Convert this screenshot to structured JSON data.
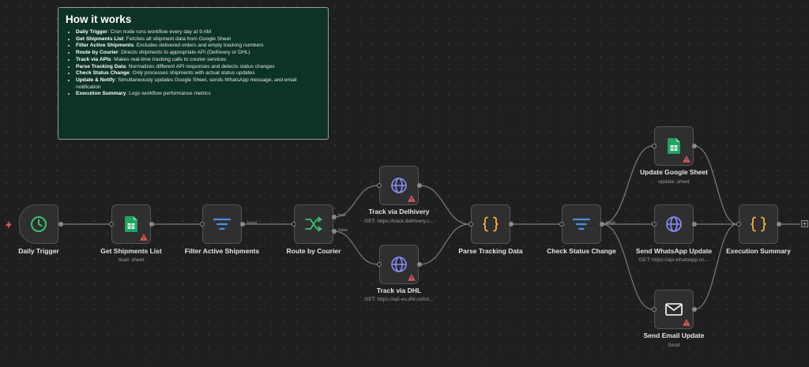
{
  "sticky": {
    "title": "How it works",
    "items": [
      {
        "term": "Daily Trigger",
        "desc": ": Cron node runs workflow every day at 9 AM"
      },
      {
        "term": "Get Shipments List",
        "desc": ": Fetches all shipment data from Google Sheet"
      },
      {
        "term": "Filter Active Shipments",
        "desc": ": Excludes delivered orders and empty tracking numbers"
      },
      {
        "term": "Route by Courier",
        "desc": ": Directs shipments to appropriate API (Delhivery or DHL)"
      },
      {
        "term": "Track via APIs",
        "desc": ": Makes real-time tracking calls to courier services"
      },
      {
        "term": "Parse Tracking Data",
        "desc": ": Normalizes different API responses and detects status changes"
      },
      {
        "term": "Check Status Change",
        "desc": ": Only processes shipments with actual status updates"
      },
      {
        "term": "Update & Notify",
        "desc": ": Simultaneously updates Google Sheet, sends WhatsApp message, and email notification"
      },
      {
        "term": "Execution Summary",
        "desc": ": Logs workflow performance metrics"
      }
    ]
  },
  "nodes": {
    "daily_trigger": {
      "label": "Daily Trigger",
      "icon": "clock-icon"
    },
    "get_shipments": {
      "label": "Get Shipments List",
      "sub": "read: sheet",
      "icon": "google-sheets-icon"
    },
    "filter_active": {
      "label": "Filter Active Shipments",
      "icon": "filter-icon"
    },
    "route_courier": {
      "label": "Route by Courier",
      "icon": "switch-icon"
    },
    "track_delhivery": {
      "label": "Track via Delhivery",
      "sub": "GET: https://track.delhivery.c...",
      "icon": "globe-icon"
    },
    "track_dhl": {
      "label": "Track via DHL",
      "sub": "GET: https://api-eu.dhl.com/t...",
      "icon": "globe-icon"
    },
    "parse_tracking": {
      "label": "Parse Tracking Data",
      "icon": "code-braces-icon"
    },
    "check_status": {
      "label": "Check Status Change",
      "icon": "filter-icon"
    },
    "update_sheet": {
      "label": "Update Google Sheet",
      "sub": "update: sheet",
      "icon": "google-sheets-icon"
    },
    "send_whatsapp": {
      "label": "Send WhatsApp Update",
      "sub": "GET: https://api.whatsapp.co...",
      "icon": "globe-icon"
    },
    "send_email": {
      "label": "Send Email Update",
      "sub": "Send",
      "icon": "envelope-icon"
    },
    "execution_summary": {
      "label": "Execution Summary",
      "icon": "code-braces-icon"
    }
  },
  "edges": {
    "kept_filter": "Kept",
    "kept_check": "Kept",
    "true_branch": "true",
    "false_branch": "false"
  },
  "colors": {
    "canvas": "#1f1f1f",
    "node_bg": "#2f2f2f",
    "sticky_bg": "#0c3324",
    "trigger_green": "#3fbf6a",
    "filter_blue": "#4a8fe0",
    "globe_purple": "#8a8fff",
    "code_orange": "#f0b23c",
    "sheets_green": "#1fa463",
    "warning_red": "#e05a5a"
  },
  "add_button": "+"
}
